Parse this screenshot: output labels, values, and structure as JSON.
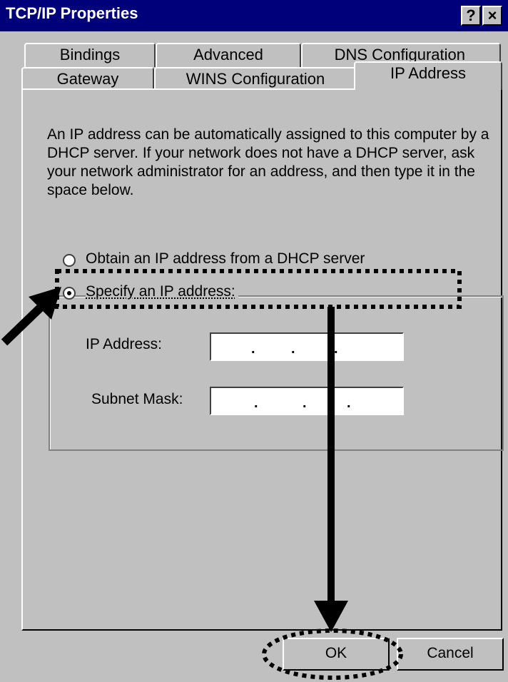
{
  "window": {
    "title": "TCP/IP Properties",
    "help_button": "?",
    "close_button": "×"
  },
  "tabs_row1": [
    "Bindings",
    "Advanced",
    "DNS Configuration"
  ],
  "tabs_row2": [
    "Gateway",
    "WINS Configuration",
    "IP Address"
  ],
  "active_tab": "IP Address",
  "description": "An IP address can be automatically assigned to this computer by a DHCP server. If your network does not have a DHCP server, ask your network administrator for an address, and then type it in the space below.",
  "radio_obtain": {
    "label": "Obtain an IP address from a DHCP server",
    "selected": false
  },
  "radio_specify": {
    "label": "Specify an IP address:",
    "selected": true
  },
  "fields": {
    "ip_address": {
      "label": "IP Address:",
      "value": ""
    },
    "subnet_mask": {
      "label": "Subnet Mask:",
      "value": ""
    }
  },
  "buttons": {
    "ok": "OK",
    "cancel": "Cancel"
  },
  "colors": {
    "titlebar": "#00007b",
    "face": "#c0c0c0"
  }
}
